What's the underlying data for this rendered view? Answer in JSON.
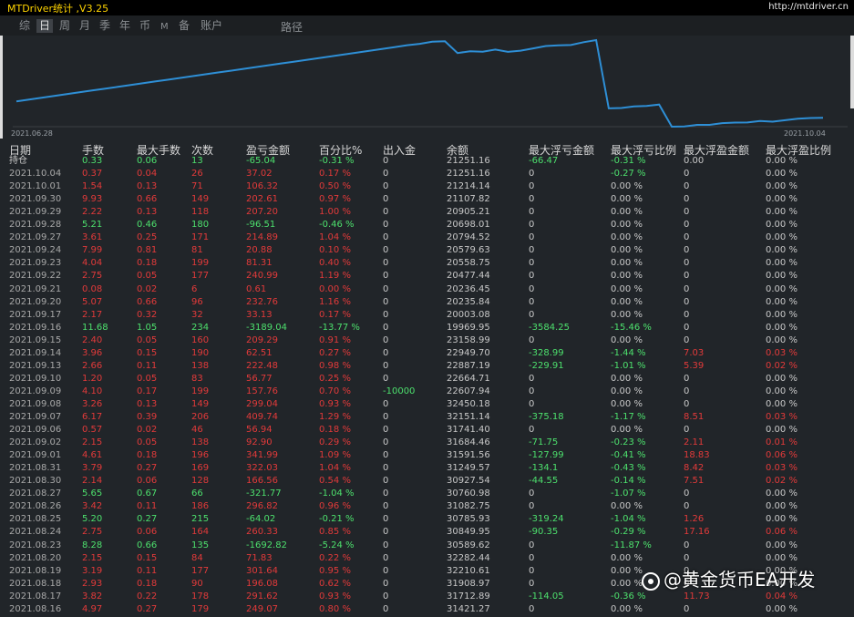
{
  "app": {
    "title": "MTDriver统计 ,V3.25",
    "url": "http://mtdriver.cn"
  },
  "toolbar": {
    "items": [
      "综",
      "日",
      "周",
      "月",
      "季",
      "年",
      "币",
      "M",
      "备",
      "账户"
    ],
    "active_index": 1,
    "path_label": "路径"
  },
  "chart": {
    "start_label": "2021.06.28",
    "end_label": "2021.10.04",
    "line_color": "#2e8fd6"
  },
  "table": {
    "headers": [
      "日期",
      "手数",
      "最大手数",
      "次数",
      "盈亏金额",
      "百分比%",
      "出入金",
      "余额",
      "最大浮亏金额",
      "最大浮亏比例",
      "最大浮盈金额",
      "最大浮盈比例"
    ],
    "rows": [
      [
        "持仓",
        "0.33",
        "0.06",
        "13",
        "-65.04",
        "-0.31 %",
        "0",
        "21251.16",
        "-66.47",
        "-0.31 %",
        "0.00",
        "0.00 %"
      ],
      [
        "2021.10.04",
        "0.37",
        "0.04",
        "26",
        "37.02",
        "0.17 %",
        "0",
        "21251.16",
        "0",
        "-0.27 %",
        "0",
        "0.00 %"
      ],
      [
        "2021.10.01",
        "1.54",
        "0.13",
        "71",
        "106.32",
        "0.50 %",
        "0",
        "21214.14",
        "0",
        "0.00 %",
        "0",
        "0.00 %"
      ],
      [
        "2021.09.30",
        "9.93",
        "0.66",
        "149",
        "202.61",
        "0.97 %",
        "0",
        "21107.82",
        "0",
        "0.00 %",
        "0",
        "0.00 %"
      ],
      [
        "2021.09.29",
        "2.22",
        "0.13",
        "118",
        "207.20",
        "1.00 %",
        "0",
        "20905.21",
        "0",
        "0.00 %",
        "0",
        "0.00 %"
      ],
      [
        "2021.09.28",
        "5.21",
        "0.46",
        "180",
        "-96.51",
        "-0.46 %",
        "0",
        "20698.01",
        "0",
        "0.00 %",
        "0",
        "0.00 %"
      ],
      [
        "2021.09.27",
        "3.61",
        "0.25",
        "171",
        "214.89",
        "1.04 %",
        "0",
        "20794.52",
        "0",
        "0.00 %",
        "0",
        "0.00 %"
      ],
      [
        "2021.09.24",
        "7.99",
        "0.81",
        "81",
        "20.88",
        "0.10 %",
        "0",
        "20579.63",
        "0",
        "0.00 %",
        "0",
        "0.00 %"
      ],
      [
        "2021.09.23",
        "4.04",
        "0.18",
        "199",
        "81.31",
        "0.40 %",
        "0",
        "20558.75",
        "0",
        "0.00 %",
        "0",
        "0.00 %"
      ],
      [
        "2021.09.22",
        "2.75",
        "0.05",
        "177",
        "240.99",
        "1.19 %",
        "0",
        "20477.44",
        "0",
        "0.00 %",
        "0",
        "0.00 %"
      ],
      [
        "2021.09.21",
        "0.08",
        "0.02",
        "6",
        "0.61",
        "0.00 %",
        "0",
        "20236.45",
        "0",
        "0.00 %",
        "0",
        "0.00 %"
      ],
      [
        "2021.09.20",
        "5.07",
        "0.66",
        "96",
        "232.76",
        "1.16 %",
        "0",
        "20235.84",
        "0",
        "0.00 %",
        "0",
        "0.00 %"
      ],
      [
        "2021.09.17",
        "2.17",
        "0.32",
        "32",
        "33.13",
        "0.17 %",
        "0",
        "20003.08",
        "0",
        "0.00 %",
        "0",
        "0.00 %"
      ],
      [
        "2021.09.16",
        "11.68",
        "1.05",
        "234",
        "-3189.04",
        "-13.77 %",
        "0",
        "19969.95",
        "-3584.25",
        "-15.46 %",
        "0",
        "0.00 %"
      ],
      [
        "2021.09.15",
        "2.40",
        "0.05",
        "160",
        "209.29",
        "0.91 %",
        "0",
        "23158.99",
        "0",
        "0.00 %",
        "0",
        "0.00 %"
      ],
      [
        "2021.09.14",
        "3.96",
        "0.15",
        "190",
        "62.51",
        "0.27 %",
        "0",
        "22949.70",
        "-328.99",
        "-1.44 %",
        "7.03",
        "0.03 %"
      ],
      [
        "2021.09.13",
        "2.66",
        "0.11",
        "138",
        "222.48",
        "0.98 %",
        "0",
        "22887.19",
        "-229.91",
        "-1.01 %",
        "5.39",
        "0.02 %"
      ],
      [
        "2021.09.10",
        "1.20",
        "0.05",
        "83",
        "56.77",
        "0.25 %",
        "0",
        "22664.71",
        "0",
        "0.00 %",
        "0",
        "0.00 %"
      ],
      [
        "2021.09.09",
        "4.10",
        "0.17",
        "199",
        "157.76",
        "0.70 %",
        "-10000",
        "22607.94",
        "0",
        "0.00 %",
        "0",
        "0.00 %"
      ],
      [
        "2021.09.08",
        "3.26",
        "0.13",
        "149",
        "299.04",
        "0.93 %",
        "0",
        "32450.18",
        "0",
        "0.00 %",
        "0",
        "0.00 %"
      ],
      [
        "2021.09.07",
        "6.17",
        "0.39",
        "206",
        "409.74",
        "1.29 %",
        "0",
        "32151.14",
        "-375.18",
        "-1.17 %",
        "8.51",
        "0.03 %"
      ],
      [
        "2021.09.06",
        "0.57",
        "0.02",
        "46",
        "56.94",
        "0.18 %",
        "0",
        "31741.40",
        "0",
        "0.00 %",
        "0",
        "0.00 %"
      ],
      [
        "2021.09.02",
        "2.15",
        "0.05",
        "138",
        "92.90",
        "0.29 %",
        "0",
        "31684.46",
        "-71.75",
        "-0.23 %",
        "2.11",
        "0.01 %"
      ],
      [
        "2021.09.01",
        "4.61",
        "0.18",
        "196",
        "341.99",
        "1.09 %",
        "0",
        "31591.56",
        "-127.99",
        "-0.41 %",
        "18.83",
        "0.06 %"
      ],
      [
        "2021.08.31",
        "3.79",
        "0.27",
        "169",
        "322.03",
        "1.04 %",
        "0",
        "31249.57",
        "-134.1",
        "-0.43 %",
        "8.42",
        "0.03 %"
      ],
      [
        "2021.08.30",
        "2.14",
        "0.06",
        "128",
        "166.56",
        "0.54 %",
        "0",
        "30927.54",
        "-44.55",
        "-0.14 %",
        "7.51",
        "0.02 %"
      ],
      [
        "2021.08.27",
        "5.65",
        "0.67",
        "66",
        "-321.77",
        "-1.04 %",
        "0",
        "30760.98",
        "0",
        "-1.07 %",
        "0",
        "0.00 %"
      ],
      [
        "2021.08.26",
        "3.42",
        "0.11",
        "186",
        "296.82",
        "0.96 %",
        "0",
        "31082.75",
        "0",
        "0.00 %",
        "0",
        "0.00 %"
      ],
      [
        "2021.08.25",
        "5.20",
        "0.27",
        "215",
        "-64.02",
        "-0.21 %",
        "0",
        "30785.93",
        "-319.24",
        "-1.04 %",
        "1.26",
        "0.00 %"
      ],
      [
        "2021.08.24",
        "2.75",
        "0.06",
        "164",
        "260.33",
        "0.85 %",
        "0",
        "30849.95",
        "-90.35",
        "-0.29 %",
        "17.16",
        "0.06 %"
      ],
      [
        "2021.08.23",
        "8.28",
        "0.66",
        "135",
        "-1692.82",
        "-5.24 %",
        "0",
        "30589.62",
        "0",
        "-11.87 %",
        "0",
        "0.00 %"
      ],
      [
        "2021.08.20",
        "2.15",
        "0.15",
        "84",
        "71.83",
        "0.22 %",
        "0",
        "32282.44",
        "0",
        "0.00 %",
        "0",
        "0.00 %"
      ],
      [
        "2021.08.19",
        "3.19",
        "0.11",
        "177",
        "301.64",
        "0.95 %",
        "0",
        "32210.61",
        "0",
        "0.00 %",
        "0",
        "0.00 %"
      ],
      [
        "2021.08.18",
        "2.93",
        "0.18",
        "90",
        "196.08",
        "0.62 %",
        "0",
        "31908.97",
        "0",
        "0.00 %",
        "0",
        "0.00 %"
      ],
      [
        "2021.08.17",
        "3.82",
        "0.22",
        "178",
        "291.62",
        "0.93 %",
        "0",
        "31712.89",
        "-114.05",
        "-0.36 %",
        "11.73",
        "0.04 %"
      ],
      [
        "2021.08.16",
        "4.97",
        "0.27",
        "179",
        "249.07",
        "0.80 %",
        "0",
        "31421.27",
        "0",
        "0.00 %",
        "0",
        "0.00 %"
      ]
    ]
  },
  "colors": {
    "positive": "#e23a3a",
    "negative": "#4de06d",
    "neutral": "#c8c8c8",
    "date": "#a8a8a8"
  },
  "watermark": "@黄金货币EA开发"
}
